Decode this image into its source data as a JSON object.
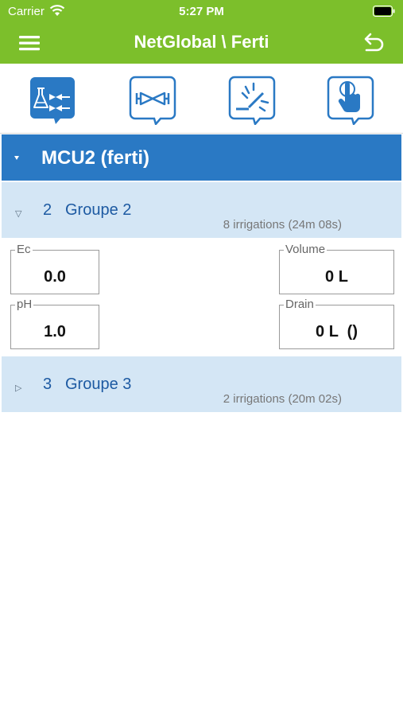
{
  "status": {
    "carrier": "Carrier",
    "time": "5:27 PM"
  },
  "nav": {
    "title": "NetGlobal \\ Ferti"
  },
  "toolbar": {
    "icons": [
      "fertilizer-mix-icon",
      "valve-icon",
      "sprinkler-icon",
      "touch-hand-icon"
    ]
  },
  "mcu": {
    "label": "MCU2 (ferti)"
  },
  "groups": [
    {
      "num": "2",
      "name": "Groupe 2",
      "info": "8 irrigations (24m 08s)",
      "expanded": true
    },
    {
      "num": "3",
      "name": "Groupe 3",
      "info": "2 irrigations (20m 02s)",
      "expanded": false
    }
  ],
  "fields": {
    "ec": {
      "label": "Ec",
      "value": "0.0"
    },
    "ph": {
      "label": "pH",
      "value": "1.0"
    },
    "volume": {
      "label": "Volume",
      "value": "0 L"
    },
    "drain": {
      "label": "Drain",
      "value": "0 L  ()"
    }
  },
  "colors": {
    "brand_green": "#7cbf2b",
    "header_blue": "#2a79c4",
    "row_blue": "#d4e6f5",
    "text_blue": "#1d5aa2"
  }
}
